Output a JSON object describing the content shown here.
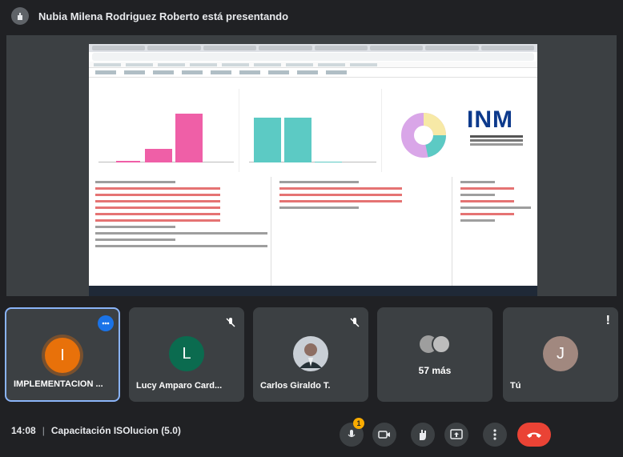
{
  "header": {
    "presenter_text": "Nubia Milena Rodriguez Roberto está presentando"
  },
  "shared_screen": {
    "logo_text": "INM",
    "colors": {
      "pink": "#ef5fa7",
      "teal": "#5ccac4",
      "lavender": "#d9a6e8",
      "yellow": "#f7e9a6",
      "logo_blue": "#0d3a8c"
    },
    "bar_levels_left": [
      0.02,
      0.22,
      0.78
    ],
    "bar_levels_right": [
      0.72,
      0.72,
      0.0
    ]
  },
  "participants": [
    {
      "name": "IMPLEMENTACION ...",
      "initial": "I",
      "avatar_color": "#e8710a",
      "speaking_badge": true
    },
    {
      "name": "Lucy Amparo Card...",
      "initial": "L",
      "avatar_color": "#0b6b4f",
      "muted": true
    },
    {
      "name": "Carlos Giraldo T.",
      "initial": "",
      "avatar_color": "#c9cfd6",
      "muted": true
    },
    {
      "name": "",
      "more_label": "57 más"
    },
    {
      "name": "Tú",
      "initial": "J",
      "avatar_color": "#a1887f",
      "alert": "!"
    }
  ],
  "footer": {
    "time": "14:08",
    "separator": "|",
    "meeting_title": "Capacitación ISOlucion (5.0)",
    "mic_notification_count": "1"
  },
  "icons": {
    "mic": "mic-off-icon",
    "camera": "camera-icon",
    "hand": "raise-hand-icon",
    "present": "present-screen-icon",
    "more": "more-options-icon",
    "hangup": "hangup-icon"
  }
}
